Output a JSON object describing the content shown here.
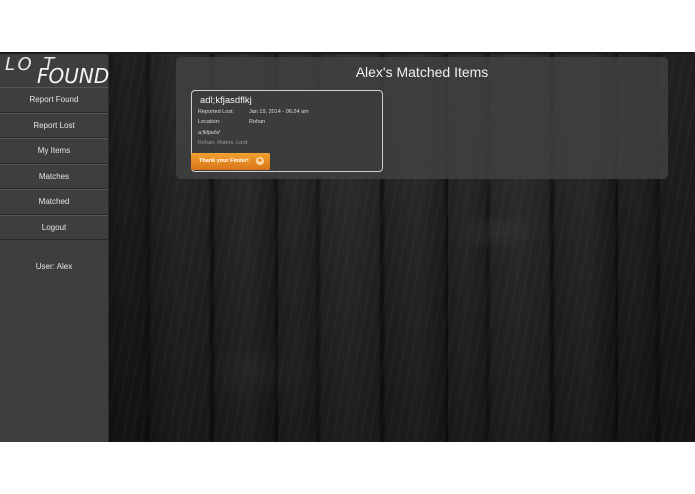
{
  "logo": {
    "line1": "LO   T",
    "line2": "FOUND"
  },
  "sidebar": {
    "items": [
      {
        "label": "Report Found"
      },
      {
        "label": "Report Lost"
      },
      {
        "label": "My Items"
      },
      {
        "label": "Matches"
      },
      {
        "label": "Matched"
      },
      {
        "label": "Logout"
      }
    ],
    "user": "User: Alex"
  },
  "main": {
    "title": "Alex's Matched Items",
    "card": {
      "title": "adl;kfjasdflkj",
      "reported_label": "Reported Lost:",
      "reported_value": "Jan 19, 2014 - 06:24 am",
      "location_label": "Location:",
      "location_value": "Rohan",
      "description": "a;lkfjadsf",
      "tags": "Rohan, Riders, Lord,",
      "button_label": "Thank your Finder!",
      "button_icon": "arrow-right-icon"
    }
  },
  "colors": {
    "sidebar": "#3e3e40",
    "accent": "#e88a24"
  }
}
